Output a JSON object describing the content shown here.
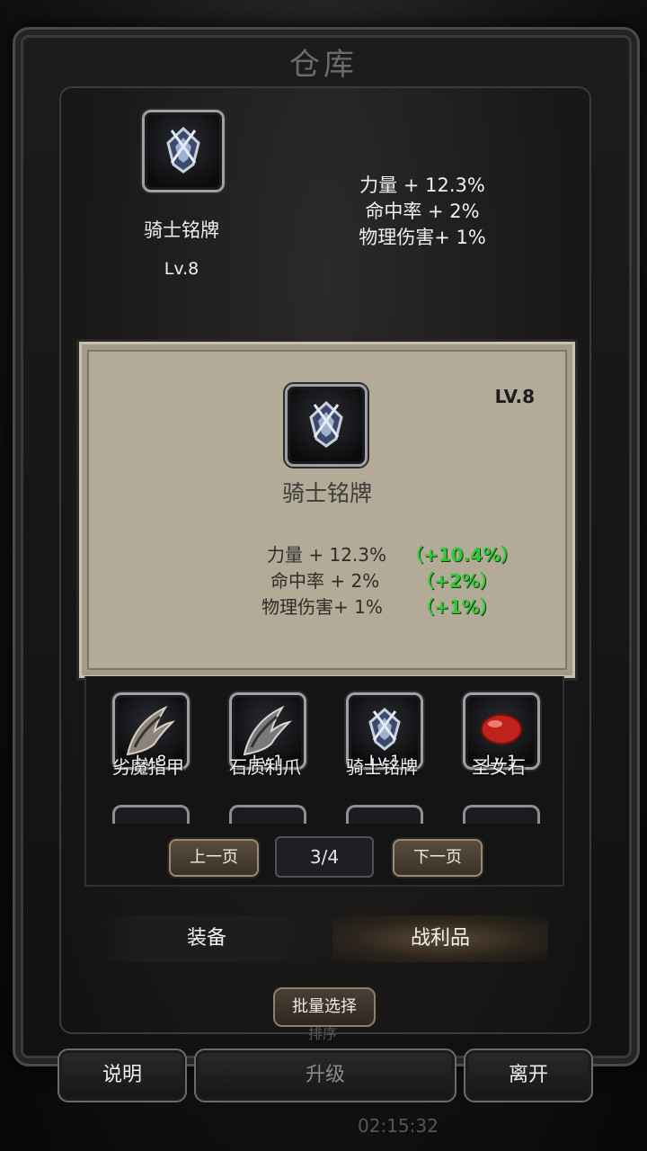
{
  "window": {
    "title": "仓库"
  },
  "selected": {
    "name": "骑士铭牌",
    "level": "Lv.8",
    "stats": [
      "力量 + 12.3%",
      "命中率 + 2%",
      "物理伤害+ 1%"
    ]
  },
  "detail": {
    "level": "LV.8",
    "name": "骑士铭牌",
    "stats": [
      "力量 + 12.3%",
      "命中率 + 2%",
      "物理伤害+ 1%"
    ],
    "bonuses": [
      "（+10.4%）",
      "（+2%）",
      "（+1%）"
    ]
  },
  "items": [
    {
      "name": "劣魔指甲",
      "level": "Lv.8",
      "icon": "claw-icon"
    },
    {
      "name": "石质利爪",
      "level": "Lv.1",
      "icon": "claw-icon"
    },
    {
      "name": "骑士铭牌",
      "level": "Lv.1",
      "icon": "emblem-icon"
    },
    {
      "name": "圣女石",
      "level": "Lv.1",
      "icon": "red-stone-icon"
    }
  ],
  "pagination": {
    "prev": "上一页",
    "page": "3/4",
    "next": "下一页"
  },
  "tabs": {
    "equipment": "装备",
    "loot": "战利品"
  },
  "batch_select": "批量选择",
  "sort": "排序",
  "buttons": {
    "help": "说明",
    "upgrade": "升级",
    "leave": "离开"
  },
  "clock": "02:15:32",
  "colors": {
    "bonus": "#30c93a",
    "detail_bg": "#b3aa98"
  }
}
